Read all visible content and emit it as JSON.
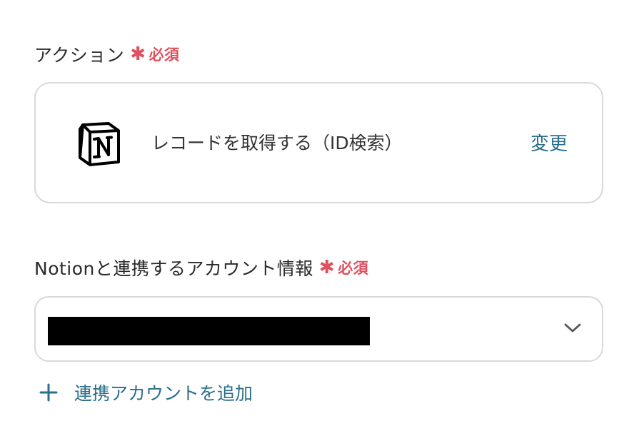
{
  "action_field": {
    "label": "アクション",
    "required_star": "✱",
    "required_text": "必須",
    "selected_action": "レコードを取得する（ID検索）",
    "change_label": "変更",
    "app_icon": "notion-logo-icon"
  },
  "account_field": {
    "label": "Notionと連携するアカウント情報",
    "required_star": "✱",
    "required_text": "必須",
    "selected_value_redacted": true
  },
  "add_account": {
    "label": "連携アカウントを追加",
    "icon": "plus-icon"
  },
  "colors": {
    "required": "#e0505f",
    "link": "#2b6f8a",
    "border": "#d9d9d9",
    "text": "#2b2b2b"
  }
}
